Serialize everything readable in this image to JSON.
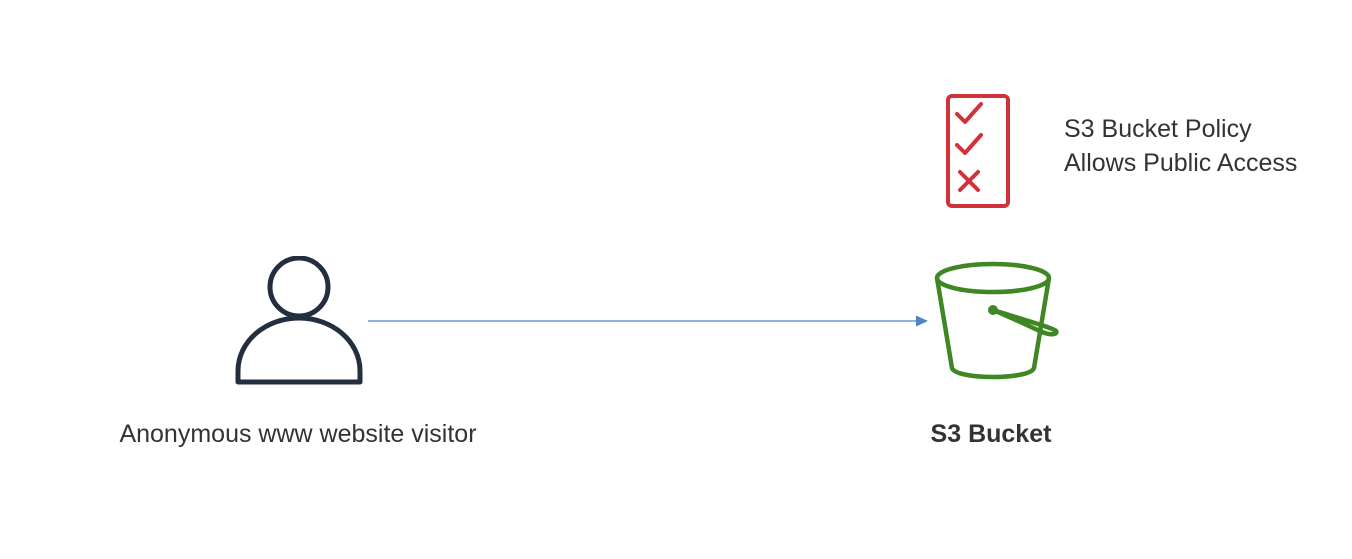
{
  "visitor": {
    "label": "Anonymous www website visitor",
    "icon": "user-icon",
    "color": "#232f3e"
  },
  "connector": {
    "color": "#4a86c5"
  },
  "policy": {
    "icon": "checklist-icon",
    "color": "#d13239",
    "line1": "S3 Bucket Policy",
    "line2": "Allows Public Access"
  },
  "bucket": {
    "icon": "bucket-icon",
    "color": "#3f8624",
    "label": "S3 Bucket"
  }
}
